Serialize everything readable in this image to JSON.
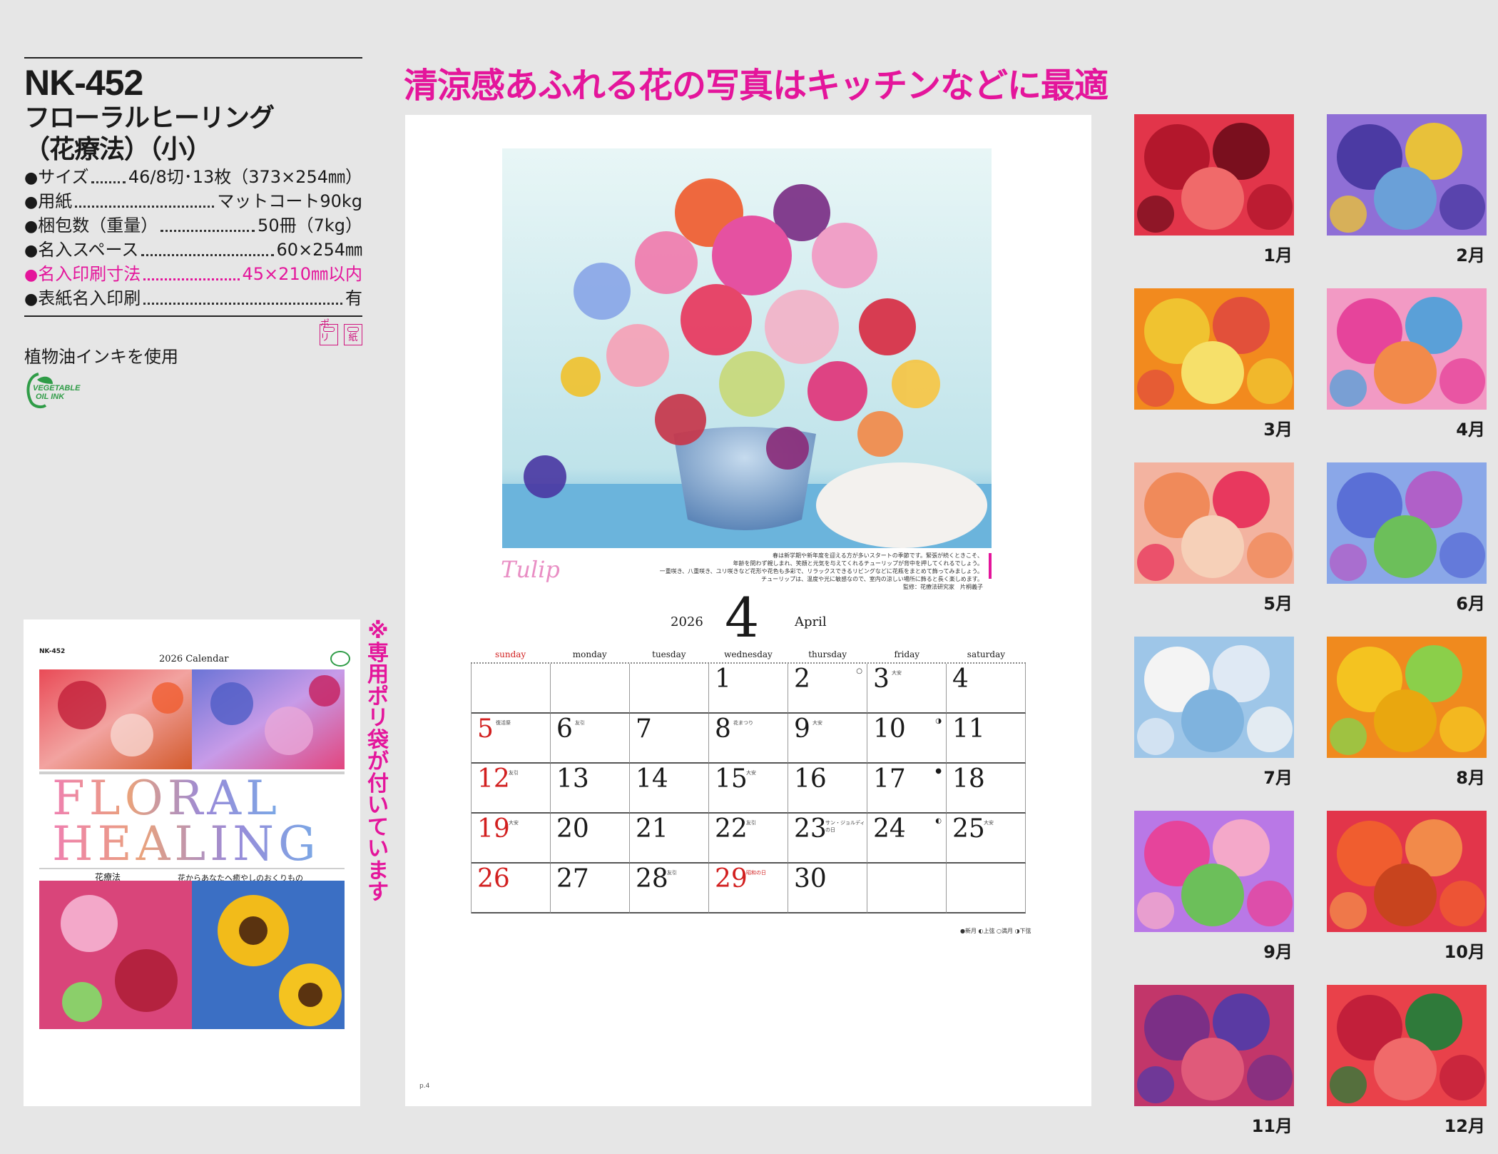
{
  "product": {
    "code": "NK-452",
    "title_line1": "フローラルヒーリング",
    "title_line2": "（花療法）（小）",
    "specs": [
      {
        "label": "サイズ",
        "value": "46/8切･13枚（373×254㎜）",
        "highlight": false
      },
      {
        "label": "用紙",
        "value": "マットコート90kg",
        "highlight": false
      },
      {
        "label": "梱包数（重量）",
        "value": "50冊（7kg）",
        "highlight": false
      },
      {
        "label": "名入スペース",
        "value": "60×254㎜",
        "highlight": false
      },
      {
        "label": "名入印刷寸法",
        "value": "45×210㎜以内",
        "highlight": true
      },
      {
        "label": "表紙名入印刷",
        "value": "有",
        "highlight": false
      }
    ],
    "tags": [
      "ポリ",
      "紙"
    ],
    "ink_note": "植物油インキを使用",
    "ink_logo_line1": "VEGETABLE",
    "ink_logo_line2": "OIL INK"
  },
  "cover": {
    "brand": "NK-452",
    "calendar_label": "2026 Calendar",
    "title_line1": "FLORAL",
    "title_line2": "HEALING",
    "subtitle_jp": "花療法",
    "tagline": "花からあなたへ癒やしのおくりもの"
  },
  "side_note": "※専用ポリ袋が付いています",
  "headline": "清涼感あふれる花の写真はキッチンなどに最適",
  "calendar_page": {
    "flower_name": "Tulip",
    "description": [
      "春は新学期や新年度を迎える方が多いスタートの季節です。緊張が続くときこそ、",
      "年齢を問わず親しまれ、笑顔と元気を与えてくれるチューリップが背中を押してくれるでしょう。",
      "一重咲き、八重咲き、ユリ咲きなど花形や花色も多彩で、リラックスできるリビングなどに花瓶をまとめて飾ってみましょう。",
      "チューリップは、温度や光に敏感なので、室内の涼しい場所に飾ると長く楽しめます。",
      "監修：花療法研究家　片桐義子"
    ],
    "year": "2026",
    "month_number": "4",
    "month_name": "April",
    "weekdays": [
      "sunday",
      "monday",
      "tuesday",
      "wednesday",
      "thursday",
      "friday",
      "saturday"
    ],
    "legend": "●新月 ◐上弦 ○満月 ◑下弦",
    "page_number": "p.4",
    "weeks": [
      [
        {
          "day": ""
        },
        {
          "day": ""
        },
        {
          "day": ""
        },
        {
          "day": "1"
        },
        {
          "day": "2",
          "moon": "○"
        },
        {
          "day": "3",
          "note": "大安"
        },
        {
          "day": "4"
        }
      ],
      [
        {
          "day": "5",
          "red": true,
          "note": "復活祭"
        },
        {
          "day": "6",
          "note": "友引"
        },
        {
          "day": "7"
        },
        {
          "day": "8",
          "note": "花まつり"
        },
        {
          "day": "9",
          "note": "大安"
        },
        {
          "day": "10",
          "moon": "◑"
        },
        {
          "day": "11"
        }
      ],
      [
        {
          "day": "12",
          "red": true,
          "note": "友引"
        },
        {
          "day": "13"
        },
        {
          "day": "14"
        },
        {
          "day": "15",
          "note": "大安"
        },
        {
          "day": "16"
        },
        {
          "day": "17",
          "moon": "●"
        },
        {
          "day": "18"
        }
      ],
      [
        {
          "day": "19",
          "red": true,
          "note": "大安"
        },
        {
          "day": "20"
        },
        {
          "day": "21"
        },
        {
          "day": "22",
          "note": "友引"
        },
        {
          "day": "23",
          "note": "サン・ジョルディの日"
        },
        {
          "day": "24",
          "moon": "◐"
        },
        {
          "day": "25",
          "note": "大安"
        }
      ],
      [
        {
          "day": "26",
          "red": true
        },
        {
          "day": "27"
        },
        {
          "day": "28",
          "note": "友引"
        },
        {
          "day": "29",
          "red": true,
          "note": "昭和の日",
          "notered": true
        },
        {
          "day": "30"
        },
        {
          "day": ""
        },
        {
          "day": ""
        }
      ]
    ]
  },
  "months": [
    "1月",
    "2月",
    "3月",
    "4月",
    "5月",
    "6月",
    "7月",
    "8月",
    "9月",
    "10月",
    "11月",
    "12月"
  ],
  "colors": {
    "accent_pink": "#e4159b",
    "holiday_red": "#d21f1f",
    "ink_green": "#2f9c47"
  }
}
